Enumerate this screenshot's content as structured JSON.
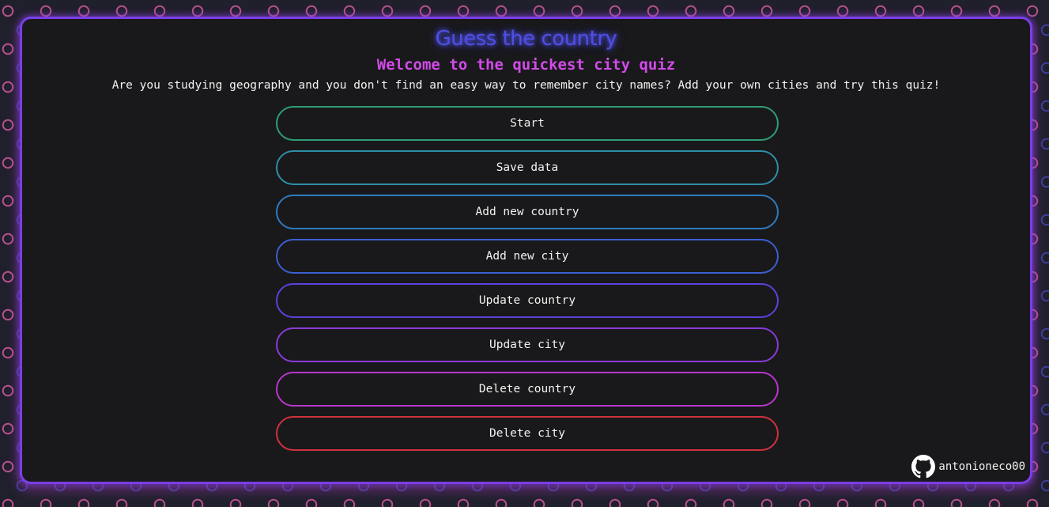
{
  "header": {
    "title": "Guess the country",
    "subtitle": "Welcome to the quickest city quiz",
    "intro": "Are you studying geography and you don't find an easy way to remember city names? Add your own cities and try this quiz!"
  },
  "menu": {
    "buttons": [
      {
        "label": "Start",
        "color": "#2f9e75"
      },
      {
        "label": "Save data",
        "color": "#2e8ea8"
      },
      {
        "label": "Add new country",
        "color": "#2e7bbf"
      },
      {
        "label": "Add new city",
        "color": "#3b5fd1"
      },
      {
        "label": "Update country",
        "color": "#5a43dc"
      },
      {
        "label": "Update city",
        "color": "#8a3ad9"
      },
      {
        "label": "Delete country",
        "color": "#b836cc"
      },
      {
        "label": "Delete city",
        "color": "#d0313f"
      }
    ]
  },
  "footer": {
    "github_icon": "github-icon",
    "github_user": "antonioneco00"
  },
  "colors": {
    "panel_border": "#7a3ee6",
    "title": "#4f4fe3",
    "subtitle": "#d24be9",
    "panel_background": "#19191b"
  }
}
